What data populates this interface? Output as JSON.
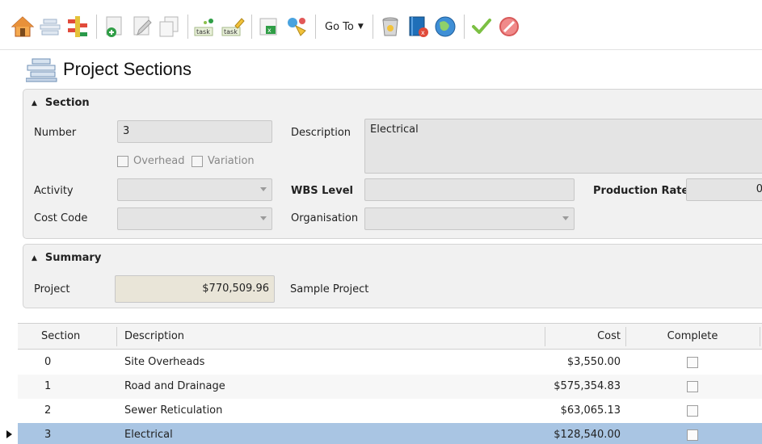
{
  "toolbar": {
    "buttons": [
      {
        "icon": "home-icon"
      },
      {
        "icon": "sections-icon"
      },
      {
        "icon": "structure-icon"
      },
      {
        "icon": "add-icon"
      },
      {
        "icon": "edit-icon"
      },
      {
        "icon": "copy-icon"
      },
      {
        "icon": "task-icon"
      },
      {
        "icon": "task-edit-icon"
      },
      {
        "icon": "excel-export-icon"
      },
      {
        "icon": "refresh-icon"
      }
    ],
    "goto_label": "Go To",
    "right_buttons": [
      {
        "icon": "delete-icon"
      },
      {
        "icon": "close-book-icon"
      },
      {
        "icon": "web-icon"
      },
      {
        "icon": "save-check-icon"
      },
      {
        "icon": "cancel-icon"
      }
    ],
    "colors": {
      "check": "#7cc043",
      "cancel": "#e25858",
      "home": "#e8913a"
    }
  },
  "page": {
    "title": "Project Sections",
    "icon": "project-sections-icon"
  },
  "section": {
    "header": "Section",
    "number_label": "Number",
    "number_value": "3",
    "overhead_label": "Overhead",
    "variation_label": "Variation",
    "description_label": "Description",
    "description_value": "Electrical",
    "activity_label": "Activity",
    "wbs_label": "WBS Level",
    "production_rate_label": "Production Rate",
    "production_rate_value": "0",
    "cost_code_label": "Cost Code",
    "organisation_label": "Organisation"
  },
  "summary": {
    "header": "Summary",
    "project_label": "Project",
    "project_value": "$770,509.96",
    "project_name": "Sample Project"
  },
  "grid": {
    "columns": [
      "Section",
      "Description",
      "Cost",
      "Complete"
    ],
    "rows": [
      {
        "section": "0",
        "description": "Site Overheads",
        "cost": "$3,550.00"
      },
      {
        "section": "1",
        "description": "Road and Drainage",
        "cost": "$575,354.83"
      },
      {
        "section": "2",
        "description": "Sewer Reticulation",
        "cost": "$63,065.13"
      },
      {
        "section": "3",
        "description": "Electrical",
        "cost": "$128,540.00"
      }
    ],
    "selected_row": 3,
    "selection_color": "#a9c5e3"
  }
}
